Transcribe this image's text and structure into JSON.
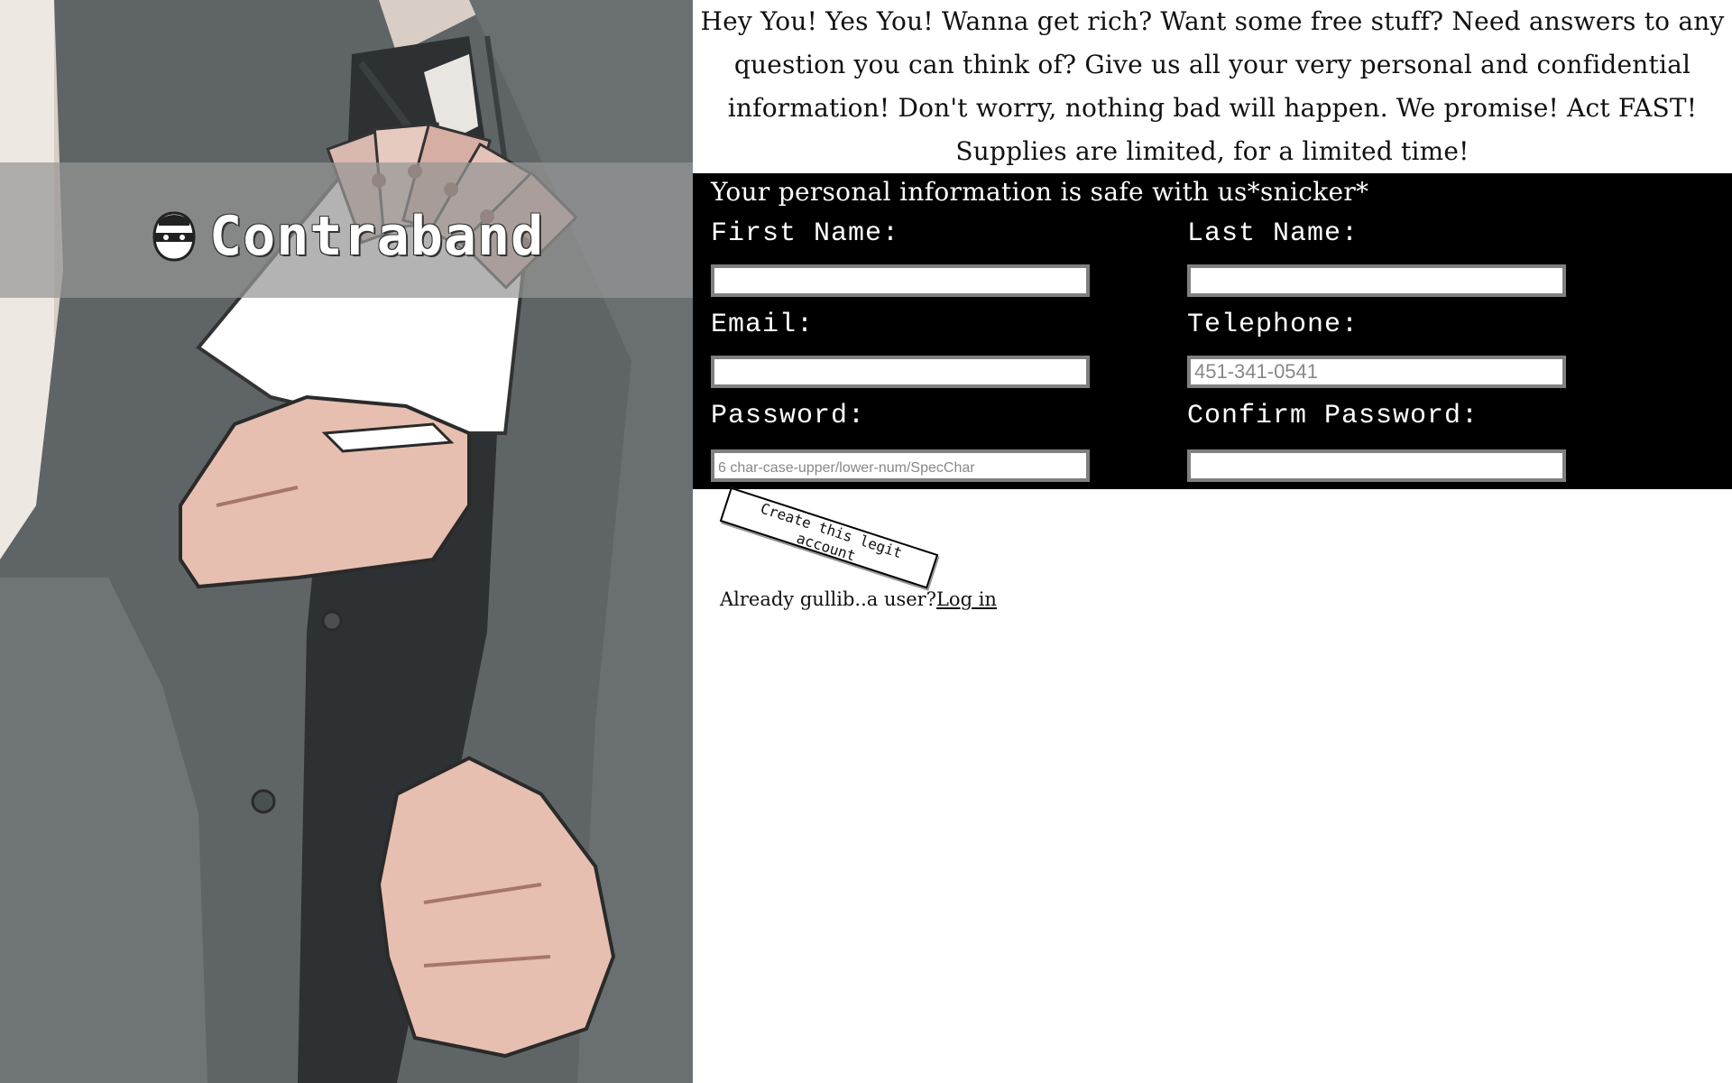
{
  "brand": {
    "name": "Contraband",
    "icon": "masked-bandit-icon"
  },
  "intro": {
    "text": "Hey You! Yes You! Wanna get rich? Want some free stuff? Need answers to any question you can think of? Give us all your very personal and confidential information! Don't worry, nothing bad will happen. We promise! Act FAST! Supplies are limited, for a limited time!"
  },
  "form": {
    "heading": "Your personal information is safe with us*snicker*",
    "first_name": {
      "label": "First Name:",
      "value": "",
      "placeholder": ""
    },
    "last_name": {
      "label": "Last Name:",
      "value": "",
      "placeholder": ""
    },
    "email": {
      "label": "Email:",
      "value": "",
      "placeholder": ""
    },
    "telephone": {
      "label": "Telephone:",
      "value": "",
      "placeholder": "451-341-0541"
    },
    "password": {
      "label": "Password:",
      "value": "",
      "placeholder": "6 char-case-upper/lower-num/SpecChar"
    },
    "confirm_password": {
      "label": "Confirm Password:",
      "value": "",
      "placeholder": ""
    },
    "submit_label": "Create this legit account"
  },
  "login": {
    "prompt": "Already gullib..a user?",
    "link_label": "Log in"
  },
  "colors": {
    "form_background": "#000000",
    "band": "#969696",
    "input_border": "#808080"
  }
}
